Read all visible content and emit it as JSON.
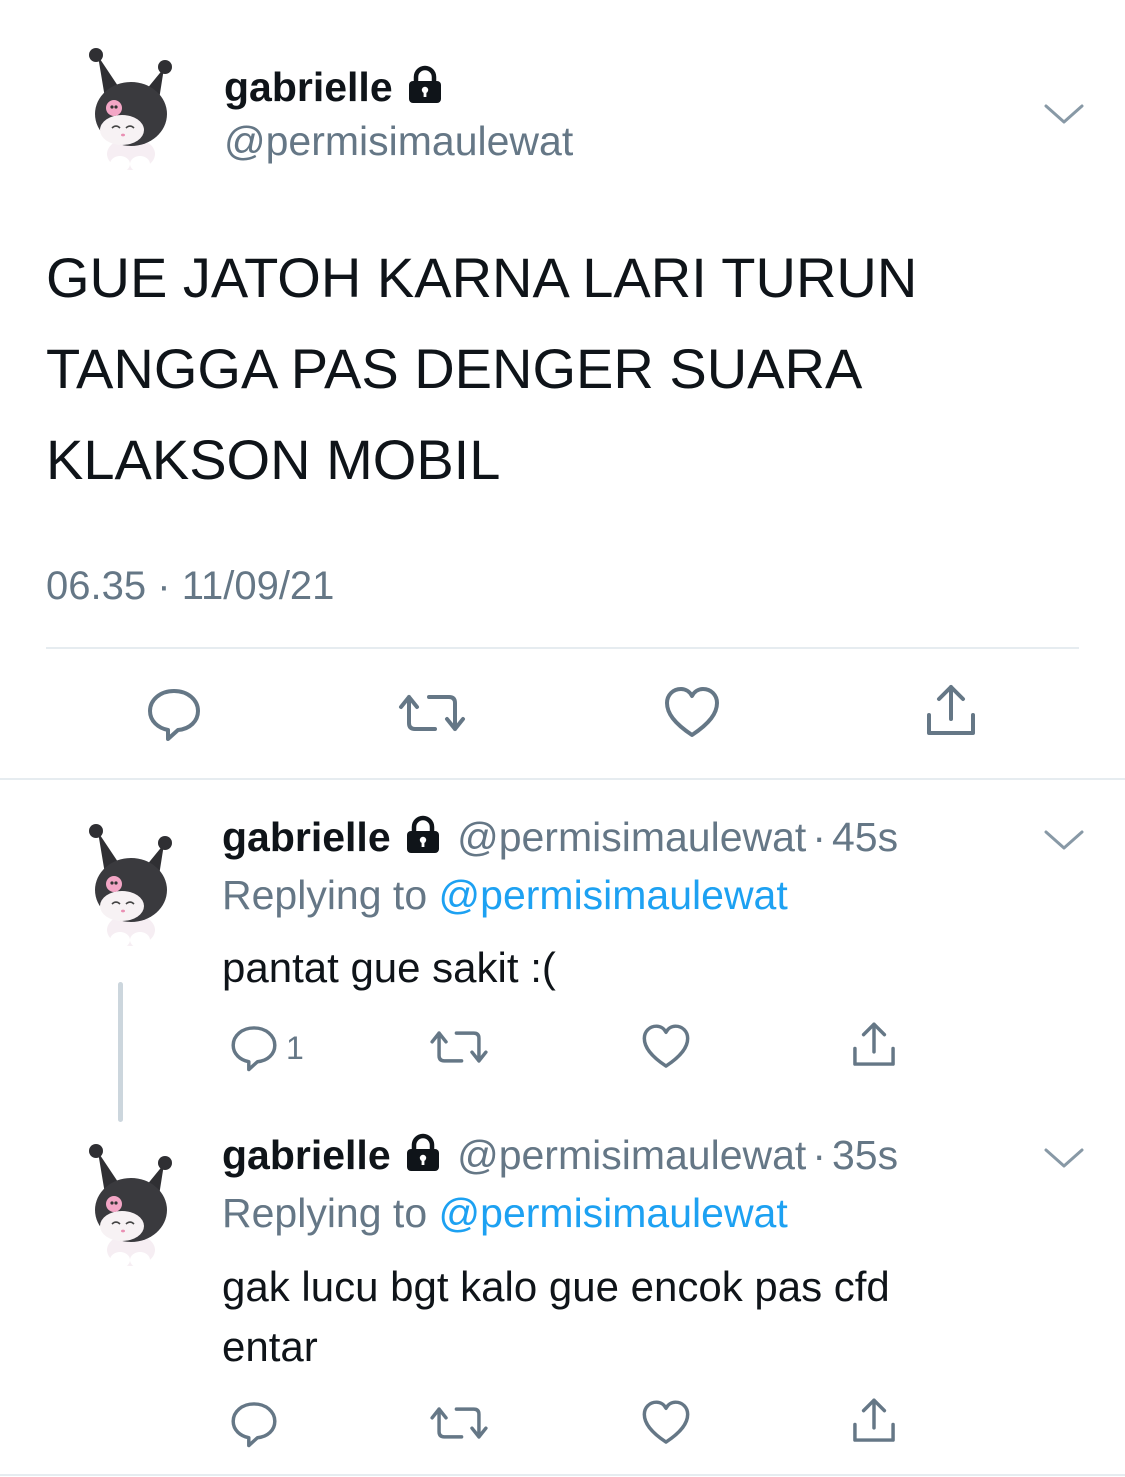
{
  "main_tweet": {
    "name": "gabrielle",
    "handle": "@permisimaulewat",
    "lines": [
      "GUE JATOH KARNA LARI TURUN",
      "TANGGA PAS DENGER SUARA",
      "KLAKSON MOBIL"
    ],
    "time": "06.35",
    "separator": "·",
    "date": "11/09/21"
  },
  "replies": [
    {
      "name": "gabrielle",
      "handle": "@permisimaulewat",
      "dot": "·",
      "time": "45s",
      "replying_prefix": "Replying to",
      "replying_handle": "@permisimaulewat",
      "lines": [
        "pantat gue sakit :("
      ],
      "reply_count": "1"
    },
    {
      "name": "gabrielle",
      "handle": "@permisimaulewat",
      "dot": "·",
      "time": "35s",
      "replying_prefix": "Replying to",
      "replying_handle": "@permisimaulewat",
      "lines": [
        "gak lucu bgt kalo gue encok pas cfd",
        "entar"
      ],
      "reply_count": ""
    }
  ],
  "icons": {
    "lock": "lock-icon",
    "chevron": "chevron-down-icon",
    "reply": "reply-icon",
    "retweet": "retweet-icon",
    "like": "heart-icon",
    "share": "share-icon"
  },
  "colors": {
    "text": "#0f1419",
    "secondary": "#657786",
    "link": "#1da1f2",
    "divider": "#e6ecf0"
  }
}
